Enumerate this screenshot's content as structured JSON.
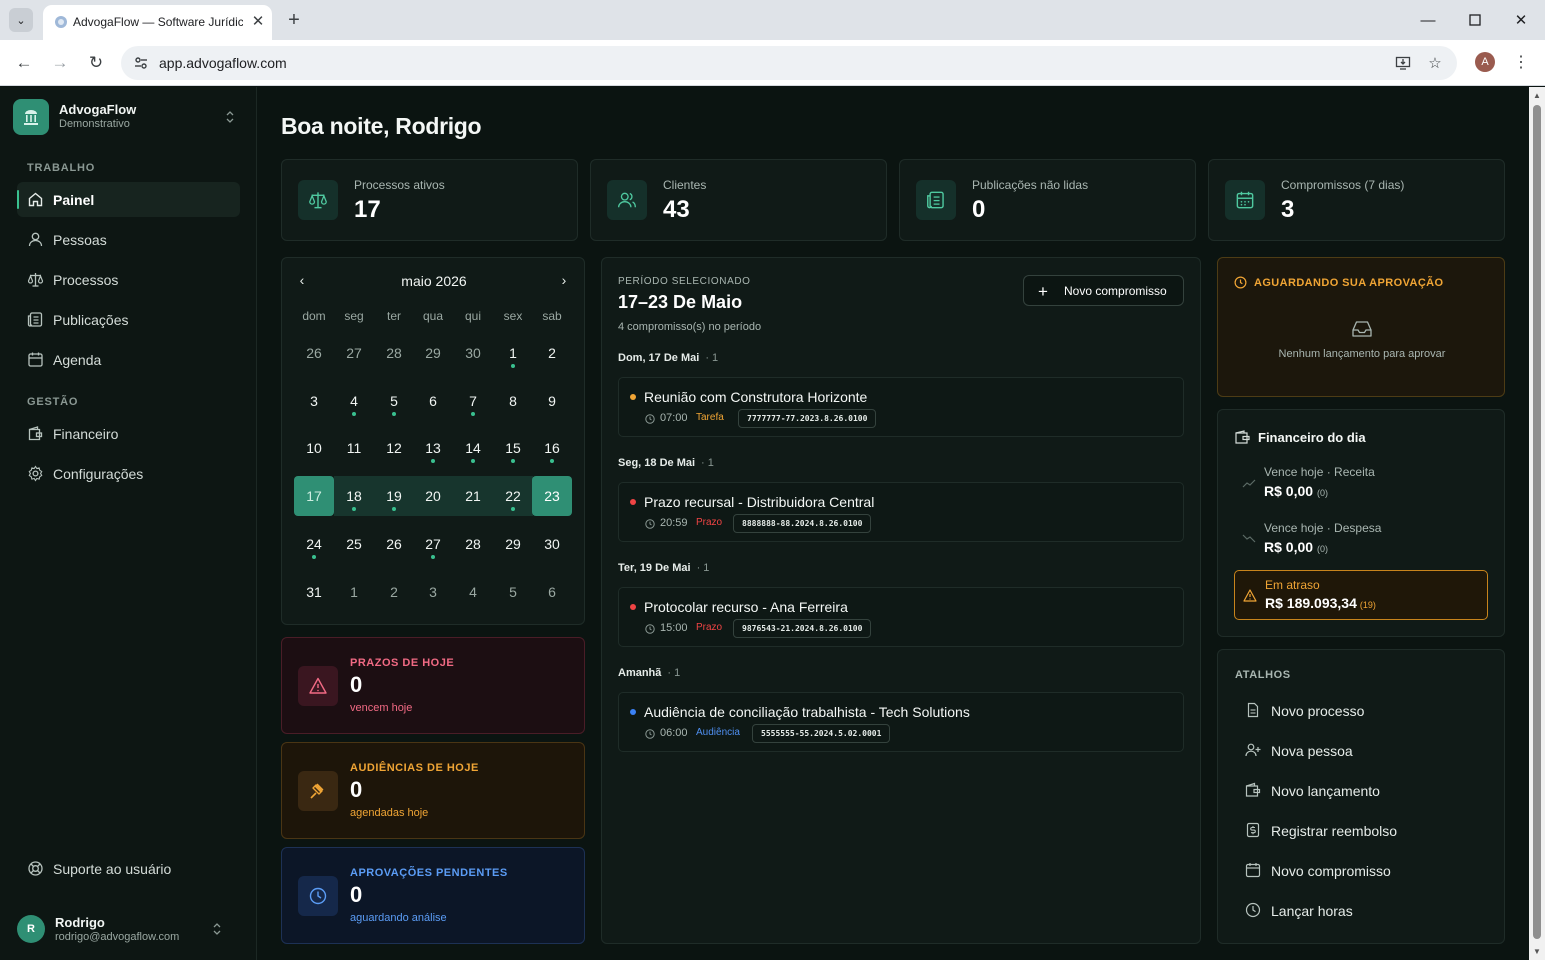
{
  "browser": {
    "tab_title": "AdvogaFlow — Software Jurídico",
    "url": "app.advogaflow.com",
    "profile_initial": "A"
  },
  "sidebar": {
    "org_name": "AdvogaFlow",
    "org_sub": "Demonstrativo",
    "section_work": "TRABALHO",
    "section_mgmt": "GESTÃO",
    "items": [
      {
        "label": "Painel",
        "icon": "home-icon",
        "active": true
      },
      {
        "label": "Pessoas",
        "icon": "user-icon"
      },
      {
        "label": "Processos",
        "icon": "scale-icon"
      },
      {
        "label": "Publicações",
        "icon": "newspaper-icon"
      },
      {
        "label": "Agenda",
        "icon": "calendar-icon"
      },
      {
        "label": "Financeiro",
        "icon": "wallet-icon"
      },
      {
        "label": "Configurações",
        "icon": "gear-icon"
      }
    ],
    "support": "Suporte ao usuário",
    "user_initial": "R",
    "user_name": "Rodrigo",
    "user_email": "rodrigo@advogaflow.com"
  },
  "greeting": "Boa noite, Rodrigo",
  "stats": [
    {
      "label": "Processos ativos",
      "value": "17",
      "icon": "scale-icon"
    },
    {
      "label": "Clientes",
      "value": "43",
      "icon": "users-icon"
    },
    {
      "label": "Publicações não lidas",
      "value": "0",
      "icon": "newspaper-icon"
    },
    {
      "label": "Compromissos (7 dias)",
      "value": "3",
      "icon": "calendar-icon"
    }
  ],
  "calendar": {
    "month": "maio 2026",
    "weekdays": [
      "dom",
      "seg",
      "ter",
      "qua",
      "qui",
      "sex",
      "sab"
    ],
    "weeks": [
      [
        "26",
        "27",
        "28",
        "29",
        "30",
        "1",
        "2"
      ],
      [
        "3",
        "4",
        "5",
        "6",
        "7",
        "8",
        "9"
      ],
      [
        "10",
        "11",
        "12",
        "13",
        "14",
        "15",
        "16"
      ],
      [
        "17",
        "18",
        "19",
        "20",
        "21",
        "22",
        "23"
      ],
      [
        "24",
        "25",
        "26",
        "27",
        "28",
        "29",
        "30"
      ],
      [
        "31",
        "1",
        "2",
        "3",
        "4",
        "5",
        "6"
      ]
    ],
    "outside_days": [
      [
        0,
        0
      ],
      [
        0,
        1
      ],
      [
        0,
        2
      ],
      [
        0,
        3
      ],
      [
        0,
        4
      ],
      [
        5,
        1
      ],
      [
        5,
        2
      ],
      [
        5,
        3
      ],
      [
        5,
        4
      ],
      [
        5,
        5
      ],
      [
        5,
        6
      ]
    ],
    "event_days": [
      [
        0,
        5
      ],
      [
        1,
        1
      ],
      [
        1,
        2
      ],
      [
        1,
        4
      ],
      [
        2,
        3
      ],
      [
        2,
        4
      ],
      [
        2,
        5
      ],
      [
        2,
        6
      ],
      [
        3,
        1
      ],
      [
        3,
        2
      ],
      [
        3,
        5
      ],
      [
        4,
        0
      ],
      [
        4,
        3
      ]
    ],
    "selected_week": 3
  },
  "summaries": [
    {
      "title": "PRAZOS DE HOJE",
      "value": "0",
      "sub": "vencem hoje",
      "icon": "warning-icon"
    },
    {
      "title": "AUDIÊNCIAS DE HOJE",
      "value": "0",
      "sub": "agendadas hoje",
      "icon": "gavel-icon"
    },
    {
      "title": "APROVAÇÕES PENDENTES",
      "value": "0",
      "sub": "aguardando análise",
      "icon": "clock-icon"
    }
  ],
  "agenda": {
    "eyebrow": "PERÍODO SELECIONADO",
    "title": "17–23 De Maio",
    "count": "4 compromisso(s) no período",
    "new_button": "Novo compromisso",
    "days": [
      {
        "label": "Dom, 17 De Mai",
        "count": "· 1",
        "event": {
          "title": "Reunião com Construtora Horizonte",
          "time": "07:00",
          "tag": "Tarefa",
          "process": "7777777-77.2023.8.26.0100",
          "color": "#f0a535"
        }
      },
      {
        "label": "Seg, 18 De Mai",
        "count": "· 1",
        "event": {
          "title": "Prazo recursal - Distribuidora Central",
          "time": "20:59",
          "tag": "Prazo",
          "process": "8888888-88.2024.8.26.0100",
          "color": "#ef4444"
        }
      },
      {
        "label": "Ter, 19 De Mai",
        "count": "· 1",
        "event": {
          "title": "Protocolar recurso - Ana Ferreira",
          "time": "15:00",
          "tag": "Prazo",
          "process": "9876543-21.2024.8.26.0100",
          "color": "#ef4444"
        }
      },
      {
        "label": "Amanhã",
        "count": "· 1",
        "event": {
          "title": "Audiência de conciliação trabalhista - Tech Solutions",
          "time": "06:00",
          "tag": "Audiência",
          "process": "5555555-55.2024.5.02.0001",
          "color": "#3b82f6"
        }
      }
    ]
  },
  "approvals": {
    "title": "AGUARDANDO SUA APROVAÇÃO",
    "empty": "Nenhum lançamento para aprovar"
  },
  "finance": {
    "title": "Financeiro do dia",
    "rows": [
      {
        "label": "Vence hoje · Receita",
        "value": "R$ 0,00",
        "count": "(0)"
      },
      {
        "label": "Vence hoje · Despesa",
        "value": "R$ 0,00",
        "count": "(0)"
      }
    ],
    "late_label": "Em atraso",
    "late_value": "R$ 189.093,34",
    "late_count": "(19)"
  },
  "shortcuts": {
    "title": "ATALHOS",
    "items": [
      {
        "label": "Novo processo",
        "icon": "file-icon"
      },
      {
        "label": "Nova pessoa",
        "icon": "user-plus-icon"
      },
      {
        "label": "Novo lançamento",
        "icon": "wallet-icon"
      },
      {
        "label": "Registrar reembolso",
        "icon": "receipt-icon"
      },
      {
        "label": "Novo compromisso",
        "icon": "calendar-plus-icon"
      },
      {
        "label": "Lançar horas",
        "icon": "clock-icon"
      }
    ]
  }
}
